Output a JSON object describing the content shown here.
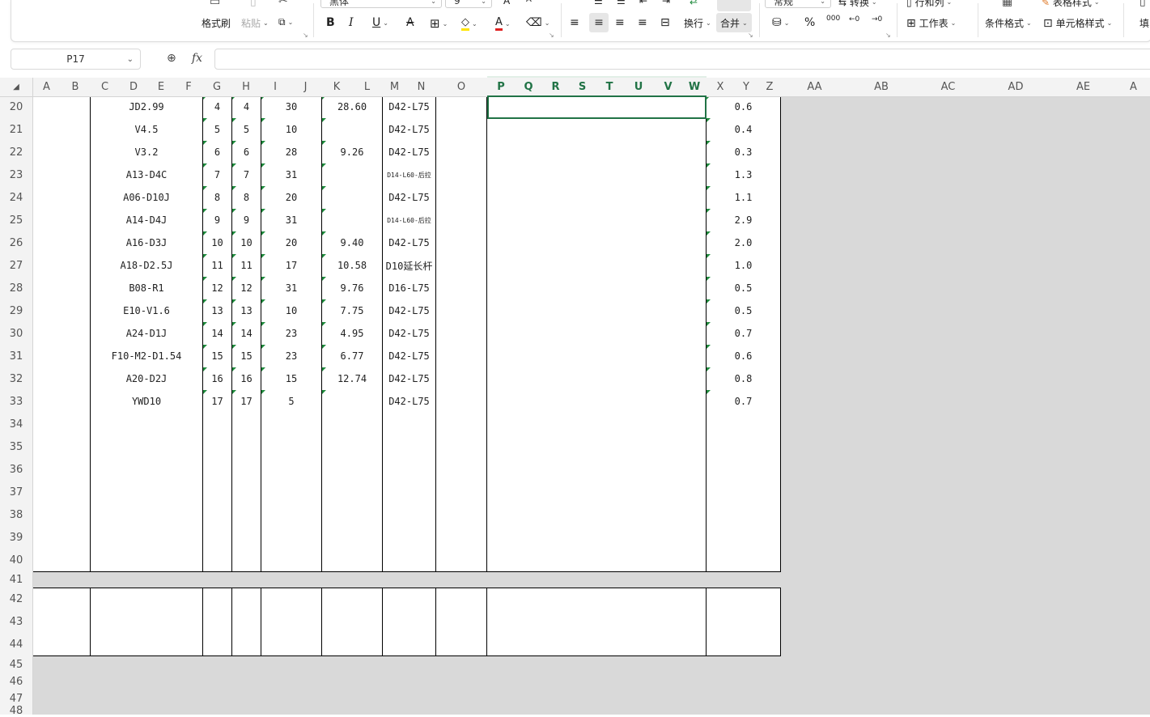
{
  "ribbon": {
    "format_painter": "格式刷",
    "paste": "粘贴",
    "font_name": "黑体",
    "font_size": "9",
    "bold": "B",
    "italic": "I",
    "underline": "U",
    "wrap_text": "换行",
    "merge": "合并",
    "number_format": "常规",
    "convert": "转换",
    "rows_cols": "行和列",
    "worksheet": "工作表",
    "conditional_format": "条件格式",
    "table_style": "表格样式",
    "cell_style": "单元格样式",
    "fill": "填"
  },
  "formula_bar": {
    "name_box": "P17",
    "fx": "fx",
    "formula": ""
  },
  "sheet": {
    "corner": "◢",
    "selected_columns": [
      "P",
      "Q",
      "R",
      "S",
      "T",
      "U",
      "V",
      "W"
    ],
    "columns": [
      "A",
      "B",
      "C",
      "D",
      "E",
      "F",
      "G",
      "H",
      "I",
      "J",
      "K",
      "L",
      "M",
      "N",
      "O",
      "P",
      "Q",
      "R",
      "S",
      "T",
      "U",
      "V",
      "W",
      "X",
      "Y",
      "Z",
      "AA",
      "AB",
      "AC",
      "AD",
      "AE",
      "A"
    ],
    "rows": [
      "20",
      "21",
      "22",
      "23",
      "24",
      "25",
      "26",
      "27",
      "28",
      "29",
      "30",
      "31",
      "32",
      "33",
      "34",
      "35",
      "36",
      "37",
      "38",
      "39",
      "40",
      "41",
      "42",
      "43",
      "44",
      "45",
      "46",
      "47",
      "48"
    ],
    "table": [
      {
        "code": "JD2.99",
        "g": "4",
        "h": "4",
        "i": "30",
        "k": "28.60",
        "m": "D42-L75",
        "y": "0.6"
      },
      {
        "code": "V4.5",
        "g": "5",
        "h": "5",
        "i": "10",
        "k": "",
        "m": "D42-L75",
        "y": "0.4"
      },
      {
        "code": "V3.2",
        "g": "6",
        "h": "6",
        "i": "28",
        "k": "9.26",
        "m": "D42-L75",
        "y": "0.3"
      },
      {
        "code": "A13-D4C",
        "g": "7",
        "h": "7",
        "i": "31",
        "k": "",
        "m": "D14-L60-后拉",
        "y": "1.3"
      },
      {
        "code": "A06-D10J",
        "g": "8",
        "h": "8",
        "i": "20",
        "k": "",
        "m": "D42-L75",
        "y": "1.1"
      },
      {
        "code": "A14-D4J",
        "g": "9",
        "h": "9",
        "i": "31",
        "k": "",
        "m": "D14-L60-后拉",
        "y": "2.9"
      },
      {
        "code": "A16-D3J",
        "g": "10",
        "h": "10",
        "i": "20",
        "k": "9.40",
        "m": "D42-L75",
        "y": "2.0"
      },
      {
        "code": "A18-D2.5J",
        "g": "11",
        "h": "11",
        "i": "17",
        "k": "10.58",
        "m": "D10延长杆",
        "y": "1.0"
      },
      {
        "code": "B08-R1",
        "g": "12",
        "h": "12",
        "i": "31",
        "k": "9.76",
        "m": "D16-L75",
        "y": "0.5"
      },
      {
        "code": "E10-V1.6",
        "g": "13",
        "h": "13",
        "i": "10",
        "k": "7.75",
        "m": "D42-L75",
        "y": "0.5"
      },
      {
        "code": "A24-D1J",
        "g": "14",
        "h": "14",
        "i": "23",
        "k": "4.95",
        "m": "D42-L75",
        "y": "0.7"
      },
      {
        "code": "F10-M2-D1.54",
        "g": "15",
        "h": "15",
        "i": "23",
        "k": "6.77",
        "m": "D42-L75",
        "y": "0.6"
      },
      {
        "code": "A20-D2J",
        "g": "16",
        "h": "16",
        "i": "15",
        "k": "12.74",
        "m": "D42-L75",
        "y": "0.8"
      },
      {
        "code": "YWD10",
        "g": "17",
        "h": "17",
        "i": "5",
        "k": "",
        "m": "D42-L75",
        "y": "0.7"
      }
    ]
  },
  "colors": {
    "accent": "#217346",
    "indicator": "#1e8a3c",
    "font_color": "#e02020",
    "highlight": "#ffe500"
  }
}
